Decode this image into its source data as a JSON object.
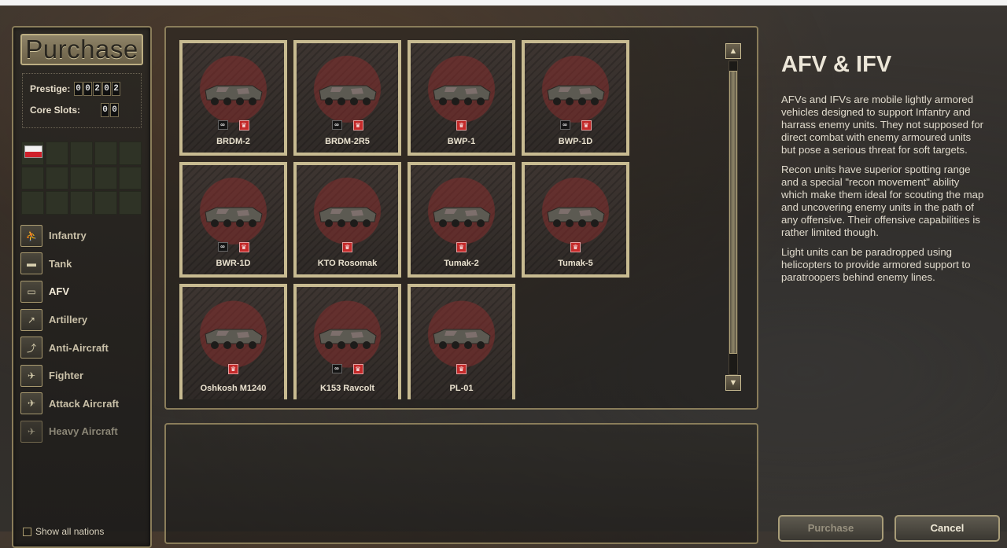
{
  "left_panel": {
    "title": "Purchase",
    "prestige": {
      "label": "Prestige:",
      "digits": [
        "0",
        "0",
        "2",
        "0",
        "2"
      ]
    },
    "core_slots": {
      "label": "Core Slots:",
      "digits": [
        "0",
        "0"
      ]
    },
    "nations": [
      {
        "name": "Poland",
        "flag": "flag-pl",
        "colors": [
          "#f2f2f2",
          "#d0202a"
        ]
      }
    ],
    "categories": [
      {
        "label": "Infantry",
        "icon": "infantry-icon",
        "state": "normal"
      },
      {
        "label": "Tank",
        "icon": "tank-icon",
        "state": "normal"
      },
      {
        "label": "AFV",
        "icon": "afv-icon",
        "state": "selected"
      },
      {
        "label": "Artillery",
        "icon": "artillery-icon",
        "state": "normal"
      },
      {
        "label": "Anti-Aircraft",
        "icon": "anti-aircraft-icon",
        "state": "normal"
      },
      {
        "label": "Fighter",
        "icon": "fighter-icon",
        "state": "normal"
      },
      {
        "label": "Attack Aircraft",
        "icon": "attack-aircraft-icon",
        "state": "normal"
      },
      {
        "label": "Heavy Aircraft",
        "icon": "heavy-aircraft-icon",
        "state": "disabled"
      }
    ],
    "show_all_nations": "Show all nations"
  },
  "units": [
    {
      "name": "BRDM-2",
      "recon": true,
      "para": true
    },
    {
      "name": "BRDM-2R5",
      "recon": true,
      "para": true
    },
    {
      "name": "BWP-1",
      "recon": false,
      "para": true
    },
    {
      "name": "BWP-1D",
      "recon": true,
      "para": true
    },
    {
      "name": "BWR-1D",
      "recon": true,
      "para": true
    },
    {
      "name": "KTO Rosomak",
      "recon": false,
      "para": true
    },
    {
      "name": "Tumak-2",
      "recon": false,
      "para": true
    },
    {
      "name": "Tumak-5",
      "recon": false,
      "para": true
    },
    {
      "name": "Oshkosh M1240",
      "recon": false,
      "para": true
    },
    {
      "name": "K153 Ravcolt",
      "recon": true,
      "para": true
    },
    {
      "name": "PL-01",
      "recon": false,
      "para": true
    }
  ],
  "info": {
    "title": "AFV & IFV",
    "paragraphs": [
      "AFVs and IFVs are mobile lightly armored vehicles designed to support Infantry and harrass enemy units. They not supposed for direct combat with enemy armoured units but pose a serious threat for soft targets.",
      "Recon units have superior spotting range and a special \"recon movement\" ability which make them ideal for scouting the map and uncovering enemy units in the path of any offensive. Their offensive capabilities is rather limited though.",
      "Light units can be paradropped using helicopters to provide armored support to paratroopers behind enemy lines."
    ]
  },
  "buttons": {
    "purchase": "Purchase",
    "cancel": "Cancel"
  },
  "colors": {
    "frame": "#c8bb91",
    "para_badge": "#c42a2a",
    "accent_gold": "#8a7d5a"
  }
}
